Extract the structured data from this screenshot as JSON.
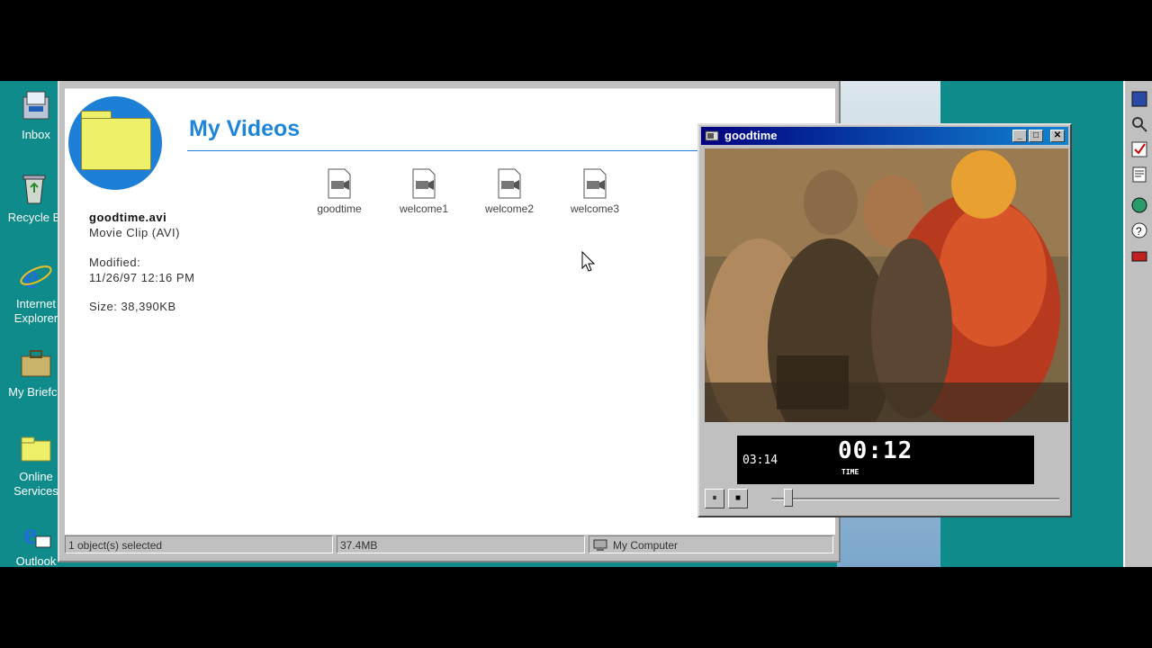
{
  "desktop": {
    "icons": [
      {
        "label": "Inbox"
      },
      {
        "label": "Recycle B"
      },
      {
        "label": "Internet Explorer"
      },
      {
        "label": "My Briefca"
      },
      {
        "label": "Online Services"
      },
      {
        "label": "Outlook"
      }
    ]
  },
  "explorer": {
    "title": "My Videos",
    "selected_file": {
      "name": "goodtime.avi",
      "type": "Movie Clip (AVI)",
      "modified_label": "Modified:",
      "modified_value": "11/26/97 12:16 PM",
      "size": "Size: 38,390KB"
    },
    "files": [
      {
        "name": "goodtime"
      },
      {
        "name": "welcome1"
      },
      {
        "name": "welcome2"
      },
      {
        "name": "welcome3"
      }
    ],
    "status": {
      "selection": "1 object(s) selected",
      "size": "37.4MB",
      "location": "My Computer"
    }
  },
  "player": {
    "title": "goodtime",
    "total_time": "03:14",
    "current_time": "00:12",
    "time_label": "TIME",
    "progress_fraction": 0.06,
    "buttons": {
      "pause": "⏸",
      "stop": "■",
      "minimize": "_",
      "maximize": "□",
      "close": "✕"
    }
  },
  "colors": {
    "accent": "#1f85d9",
    "titlebar": "#000080",
    "desktop": "#0e8b8a"
  }
}
